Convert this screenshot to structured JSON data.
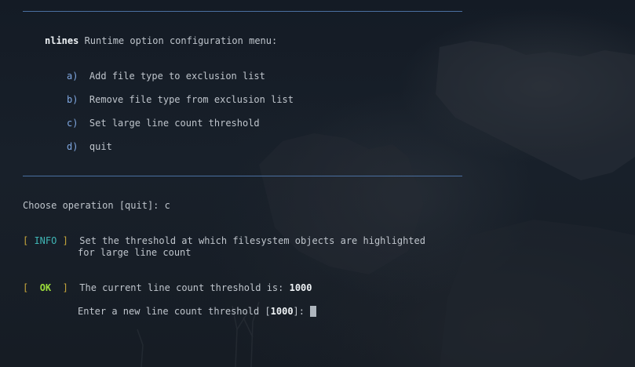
{
  "menu": {
    "program_name": "nlines",
    "title_rest": " Runtime option configuration menu:",
    "options": [
      {
        "key": "a",
        "label": "Add file type to exclusion list"
      },
      {
        "key": "b",
        "label": "Remove file type from exclusion list"
      },
      {
        "key": "c",
        "label": "Set large line count threshold"
      },
      {
        "key": "d",
        "label": "quit"
      }
    ]
  },
  "prompt": {
    "text": "Choose operation [quit]: ",
    "input": "c"
  },
  "info": {
    "tag": "INFO",
    "line1": "Set the threshold at which filesystem objects are highlighted",
    "line2": "for large line count"
  },
  "ok": {
    "tag": "OK",
    "text": "The current line count threshold is: ",
    "value": "1000"
  },
  "entry": {
    "text_before": "Enter a new line count threshold [",
    "default": "1000",
    "text_after": "]: "
  },
  "colors": {
    "background": "#141b24",
    "rule": "#4a6fa0",
    "text": "#bfc5cc",
    "key": "#7fa7e0",
    "bracket": "#c7a73c",
    "info_tag": "#3fb5b5",
    "ok_tag": "#9bdc3a"
  }
}
